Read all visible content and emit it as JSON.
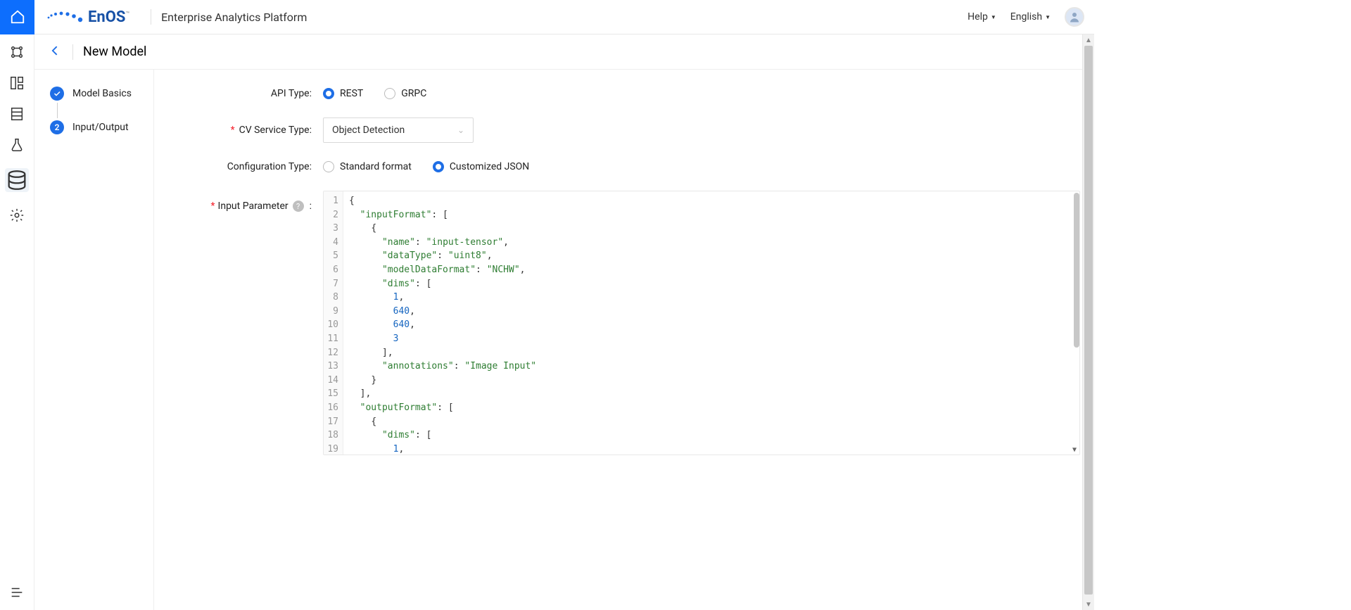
{
  "header": {
    "brand_en": "En",
    "brand_os": "OS",
    "tm": "™",
    "platform_title": "Enterprise Analytics Platform",
    "help_label": "Help",
    "language_label": "English"
  },
  "page": {
    "title": "New Model"
  },
  "steps": {
    "items": [
      {
        "label": "Model Basics",
        "state": "done"
      },
      {
        "label": "Input/Output",
        "state": "active",
        "number": "2"
      }
    ]
  },
  "form": {
    "api_type": {
      "label": "API Type:",
      "options": [
        "REST",
        "GRPC"
      ],
      "selected": "REST"
    },
    "cv_service_type": {
      "label": "CV Service Type:",
      "value": "Object Detection"
    },
    "configuration_type": {
      "label": "Configuration Type:",
      "options": [
        "Standard format",
        "Customized JSON"
      ],
      "selected": "Customized JSON"
    },
    "input_parameter": {
      "label": "Input Parameter",
      "help": "?",
      "colon": ":"
    }
  },
  "editor": {
    "line_count": 19,
    "tokens": [
      [
        {
          "t": "punc",
          "v": "{"
        }
      ],
      [
        {
          "t": "ind",
          "v": "  "
        },
        {
          "t": "key",
          "v": "\"inputFormat\""
        },
        {
          "t": "punc",
          "v": ": ["
        }
      ],
      [
        {
          "t": "ind",
          "v": "    "
        },
        {
          "t": "punc",
          "v": "{"
        }
      ],
      [
        {
          "t": "ind",
          "v": "      "
        },
        {
          "t": "key",
          "v": "\"name\""
        },
        {
          "t": "punc",
          "v": ": "
        },
        {
          "t": "str",
          "v": "\"input-tensor\""
        },
        {
          "t": "punc",
          "v": ","
        }
      ],
      [
        {
          "t": "ind",
          "v": "      "
        },
        {
          "t": "key",
          "v": "\"dataType\""
        },
        {
          "t": "punc",
          "v": ": "
        },
        {
          "t": "str",
          "v": "\"uint8\""
        },
        {
          "t": "punc",
          "v": ","
        }
      ],
      [
        {
          "t": "ind",
          "v": "      "
        },
        {
          "t": "key",
          "v": "\"modelDataFormat\""
        },
        {
          "t": "punc",
          "v": ": "
        },
        {
          "t": "str",
          "v": "\"NCHW\""
        },
        {
          "t": "punc",
          "v": ","
        }
      ],
      [
        {
          "t": "ind",
          "v": "      "
        },
        {
          "t": "key",
          "v": "\"dims\""
        },
        {
          "t": "punc",
          "v": ": ["
        }
      ],
      [
        {
          "t": "ind",
          "v": "        "
        },
        {
          "t": "num",
          "v": "1"
        },
        {
          "t": "punc",
          "v": ","
        }
      ],
      [
        {
          "t": "ind",
          "v": "        "
        },
        {
          "t": "num",
          "v": "640"
        },
        {
          "t": "punc",
          "v": ","
        }
      ],
      [
        {
          "t": "ind",
          "v": "        "
        },
        {
          "t": "num",
          "v": "640"
        },
        {
          "t": "punc",
          "v": ","
        }
      ],
      [
        {
          "t": "ind",
          "v": "        "
        },
        {
          "t": "num",
          "v": "3"
        }
      ],
      [
        {
          "t": "ind",
          "v": "      "
        },
        {
          "t": "punc",
          "v": "],"
        }
      ],
      [
        {
          "t": "ind",
          "v": "      "
        },
        {
          "t": "key",
          "v": "\"annotations\""
        },
        {
          "t": "punc",
          "v": ": "
        },
        {
          "t": "str",
          "v": "\"Image Input\""
        }
      ],
      [
        {
          "t": "ind",
          "v": "    "
        },
        {
          "t": "punc",
          "v": "}"
        }
      ],
      [
        {
          "t": "ind",
          "v": "  "
        },
        {
          "t": "punc",
          "v": "],"
        }
      ],
      [
        {
          "t": "ind",
          "v": "  "
        },
        {
          "t": "key",
          "v": "\"outputFormat\""
        },
        {
          "t": "punc",
          "v": ": ["
        }
      ],
      [
        {
          "t": "ind",
          "v": "    "
        },
        {
          "t": "punc",
          "v": "{"
        }
      ],
      [
        {
          "t": "ind",
          "v": "      "
        },
        {
          "t": "key",
          "v": "\"dims\""
        },
        {
          "t": "punc",
          "v": ": ["
        }
      ],
      [
        {
          "t": "ind",
          "v": "        "
        },
        {
          "t": "num",
          "v": "1"
        },
        {
          "t": "punc",
          "v": ","
        }
      ]
    ]
  }
}
